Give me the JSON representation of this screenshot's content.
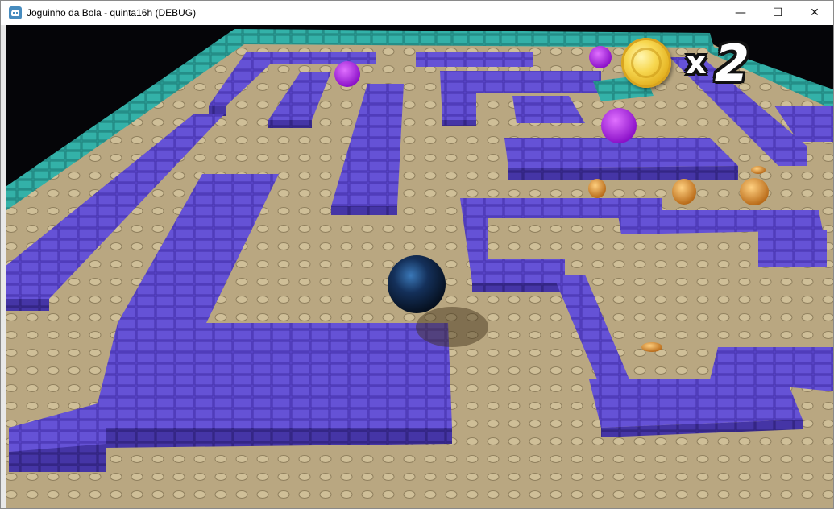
{
  "window": {
    "title": "Joguinho da Bola - quinta16h (DEBUG)",
    "controls": {
      "minimize": "—",
      "maximize": "☐",
      "close": "✕"
    }
  },
  "hud": {
    "multiplier": "x",
    "coin_count": "2"
  },
  "colors": {
    "floor": "#b7a57f",
    "wall_top": "#5a45c9",
    "wall_side": "#3a2a8e",
    "border_wall": "#2aa39a",
    "ball": "#10203a",
    "coin": "#d48a2a",
    "spike_ball": "#a020e0"
  },
  "icons": [
    "godot-app-icon",
    "coin-icon",
    "minimize-icon",
    "maximize-icon",
    "close-icon"
  ]
}
